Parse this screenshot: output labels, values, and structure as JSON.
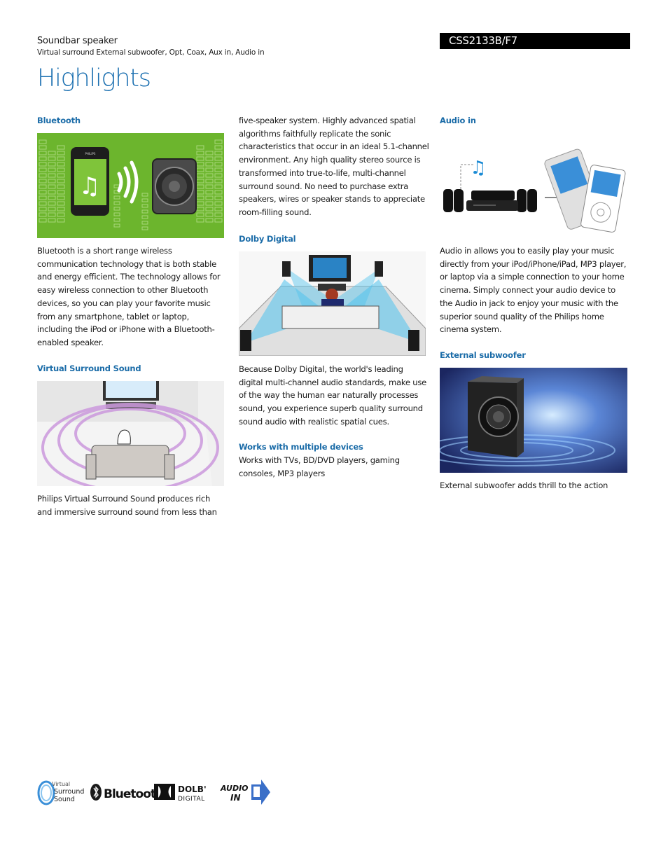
{
  "header": {
    "product_type": "Soundbar speaker",
    "product_description": "Virtual surround External subwoofer, Opt, Coax, Aux in, Audio in",
    "page_title": "Highlights",
    "model_number": "CSS2133B/F7"
  },
  "colors": {
    "heading_blue": "#1b6ca8",
    "title_blue": "#1a6fb0",
    "model_bar": "#000000",
    "bluetooth_green": "#6cb52d"
  },
  "features": {
    "bluetooth": {
      "heading": "Bluetooth",
      "image_alt": "bluetooth-phone-to-speaker-illustration",
      "phone_brand": "PHILIPS",
      "text": "Bluetooth is a short range wireless communication technology that is both stable and energy efficient. The technology allows for easy wireless connection to other Bluetooth devices, so you can play your favorite music from any smartphone, tablet or laptop, including the iPod or iPhone with a Bluetooth-enabled speaker."
    },
    "virtual_surround": {
      "heading": "Virtual Surround Sound",
      "image_alt": "virtual-surround-room-illustration",
      "text": "Philips Virtual Surround Sound produces rich and immersive surround sound from less than",
      "text_continued": "five-speaker system. Highly advanced spatial algorithms faithfully replicate the sonic characteristics that occur in an ideal 5.1-channel environment. Any high quality stereo source is transformed into true-to-life, multi-channel surround sound. No need to purchase extra speakers, wires or speaker stands to appreciate room-filling sound."
    },
    "dolby_digital": {
      "heading": "Dolby Digital",
      "image_alt": "dolby-digital-5-1-room-illustration",
      "text": "Because Dolby Digital, the world's leading digital multi-channel audio standards, make use of the way the human ear naturally processes sound, you experience superb quality surround sound audio with realistic spatial cues."
    },
    "multiple_devices": {
      "heading": "Works with multiple devices",
      "text": "Works with TVs, BD/DVD players, gaming consoles, MP3 players"
    },
    "audio_in": {
      "heading": "Audio in",
      "image_alt": "audio-in-mp3-player-illustration",
      "text": "Audio in allows you to easily play your music directly from your iPod/iPhone/iPad, MP3 player, or laptop via a simple connection to your home cinema. Simply connect your audio device to the Audio in jack to enjoy your music with the superior sound quality of the Philips home cinema system."
    },
    "external_subwoofer": {
      "heading": "External subwoofer",
      "image_alt": "subwoofer-illustration",
      "text": "External subwoofer adds thrill to the action"
    }
  },
  "logos": {
    "virtual_surround": {
      "line1": "Virtual",
      "line2": "Surround",
      "line3": "Sound"
    },
    "bluetooth": {
      "label": "Bluetootl"
    },
    "dolby": {
      "line1": "DOLB'",
      "line2": "DIGITAL"
    },
    "audio_in": {
      "line1": "AUDIO",
      "line2": "IN"
    }
  }
}
